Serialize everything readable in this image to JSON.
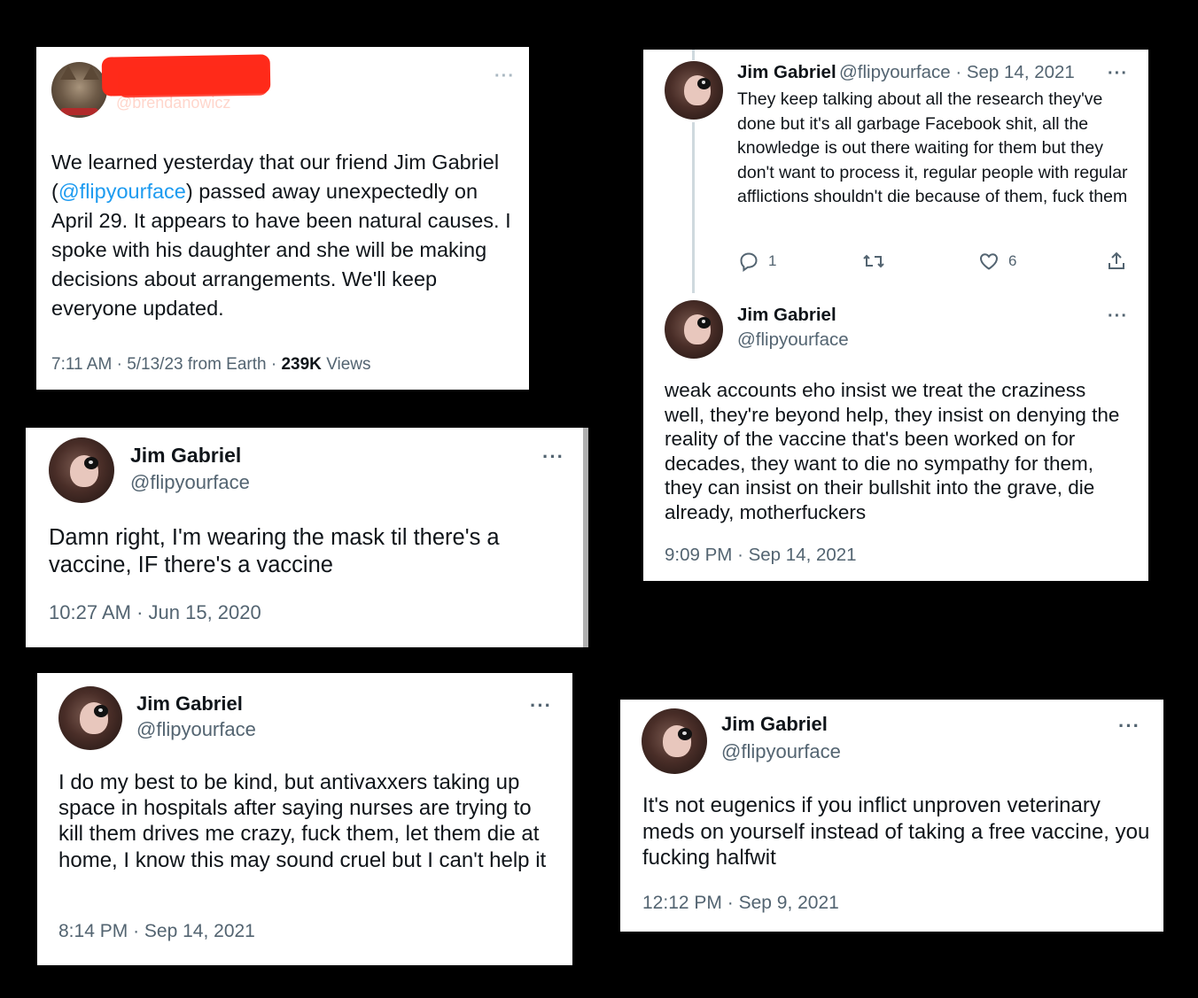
{
  "card1": {
    "handle_fragment": "@brendanowicz",
    "body_before": "We learned yesterday that our friend Jim Gabriel (",
    "body_mention": "@flipyourface",
    "body_after": ") passed away unexpectedly on April 29. It appears to have been natural causes. I spoke with his daughter and she will be making decisions about arrangements. We'll keep everyone updated.",
    "time": "7:11 AM",
    "date": "5/13/23",
    "source": "from Earth",
    "views_count": "239K",
    "views_label": "Views",
    "more_icon": "more-icon"
  },
  "card2": {
    "name": "Jim Gabriel",
    "handle": "@flipyourface",
    "body": "Damn right, I'm wearing the mask til there's a vaccine, IF there's a vaccine",
    "time": "10:27 AM",
    "date": "Jun 15, 2020"
  },
  "card3": {
    "name": "Jim Gabriel",
    "handle": "@flipyourface",
    "body": "I do my best to be kind, but antivaxxers taking up space in hospitals after saying nurses are trying to kill them drives me crazy, fuck them, let them die at home, I know this may sound cruel but I can't help it",
    "time": "8:14 PM",
    "date": "Sep 14, 2021"
  },
  "card4": {
    "tweet1": {
      "name": "Jim Gabriel",
      "handle_date": "@flipyourface · Sep 14, 2021",
      "body": "They keep talking about all the research they've done but it's all garbage Facebook shit, all the knowledge is out there waiting for them but they don't want to process it, regular people with regular afflictions shouldn't die because of them, fuck them",
      "replies": "1",
      "likes": "6"
    },
    "tweet2": {
      "name": "Jim Gabriel",
      "handle": "@flipyourface",
      "body": "weak accounts eho insist we treat the craziness well, they're beyond help, they insist on denying the reality of the vaccine that's been worked on for decades, they want to die no sympathy for them, they can insist on their bullshit into the grave, die already, motherfuckers",
      "time": "9:09 PM",
      "date": "Sep 14, 2021"
    }
  },
  "card5": {
    "name": "Jim Gabriel",
    "handle": "@flipyourface",
    "body": "It's not eugenics if you inflict unproven veterinary meds on yourself instead of taking a free vaccine, you fucking halfwit",
    "time": "12:12 PM",
    "date": "Sep 9, 2021"
  },
  "common": {
    "more_dots": "···",
    "separator": "·"
  },
  "colors": {
    "background": "#000000",
    "card": "#ffffff",
    "text": "#0f1419",
    "secondary": "#536471",
    "link": "#1d9bf0",
    "redaction": "#ff2a1a"
  }
}
